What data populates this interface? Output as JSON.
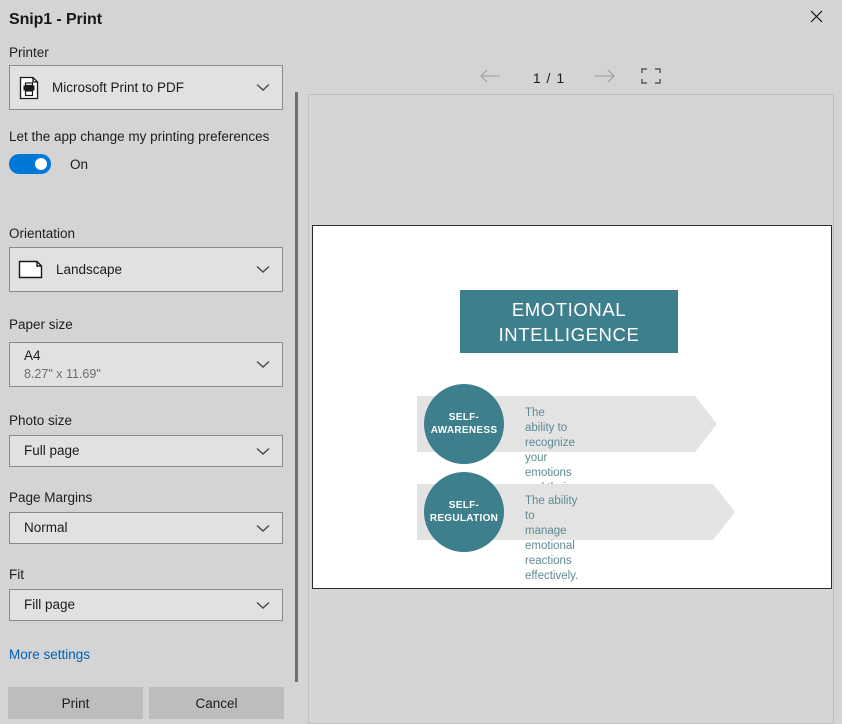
{
  "window": {
    "title": "Snip1 - Print",
    "close_icon": "close-icon"
  },
  "settings": {
    "printer": {
      "label": "Printer",
      "value": "Microsoft Print to PDF",
      "icon": "printer-document-icon"
    },
    "app_preferences": {
      "label": "Let the app change my printing preferences",
      "state": "On",
      "enabled": true,
      "accent_color": "#0078d7"
    },
    "orientation": {
      "label": "Orientation",
      "value": "Landscape",
      "icon": "landscape-page-icon"
    },
    "paper_size": {
      "label": "Paper size",
      "value": "A4",
      "dimensions": "8.27\" x 11.69\""
    },
    "photo_size": {
      "label": "Photo size",
      "value": "Full page"
    },
    "page_margins": {
      "label": "Page Margins",
      "value": "Normal"
    },
    "fit": {
      "label": "Fit",
      "value": "Fill page"
    },
    "more_settings_label": "More settings",
    "more_settings_color": "#005fb8"
  },
  "footer": {
    "print_label": "Print",
    "cancel_label": "Cancel"
  },
  "preview": {
    "prev_icon": "arrow-left-icon",
    "next_icon": "arrow-right-icon",
    "fit_icon": "fit-to-page-icon",
    "current_page": "1",
    "page_separator": "/",
    "total_pages": "1",
    "page_indicator": "1 / 1"
  },
  "slide": {
    "title_lines": [
      "EMOTIONAL",
      "INTELLIGENCE"
    ],
    "title_bg_color": "#3d7f8c",
    "title_text_color": "#ffffff",
    "banner_bg_color": "#e3e3e3",
    "desc_text_color": "#5e8a93",
    "points": [
      {
        "circle_lines": [
          "SELF-",
          "AWARENESS"
        ],
        "desc_lines": [
          "The ability to recognize your",
          "emotions and their impact."
        ]
      },
      {
        "circle_lines": [
          "SELF-",
          "REGULATION"
        ],
        "desc_lines": [
          "The ability to manage",
          "emotional reactions effectively."
        ]
      }
    ]
  }
}
